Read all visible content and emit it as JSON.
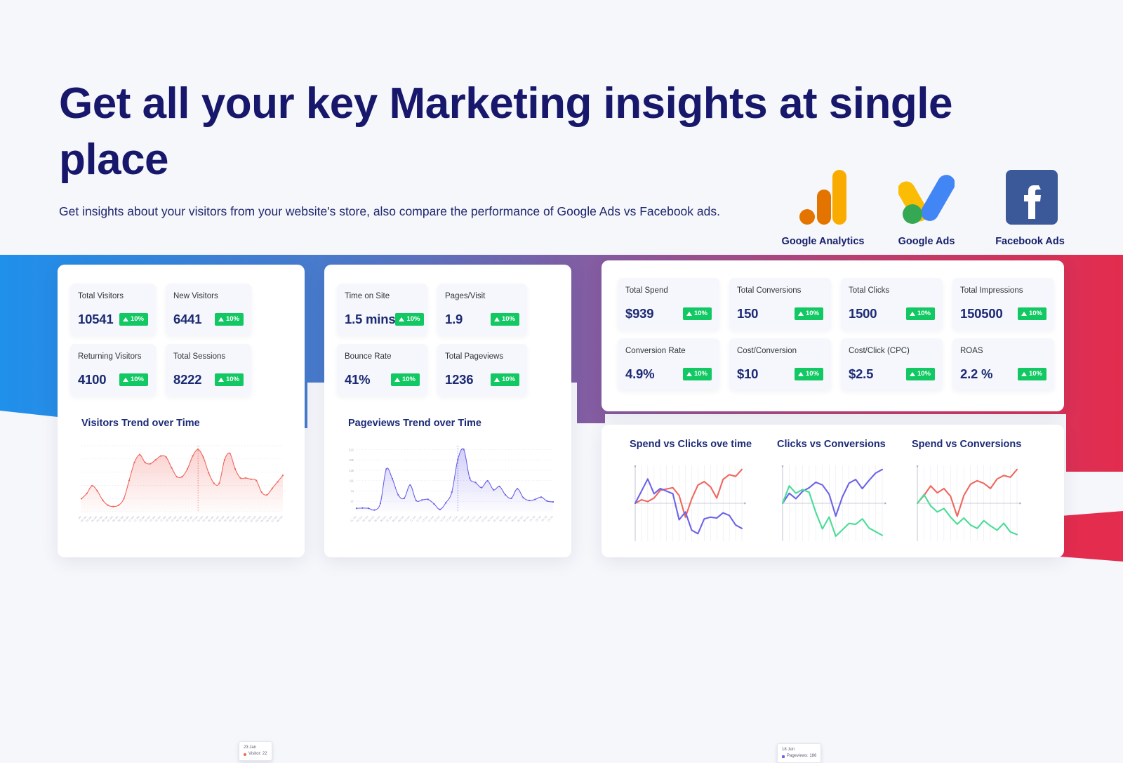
{
  "header": {
    "title": "Get all your key Marketing insights at single place",
    "subtitle": "Get insights about your visitors from your website's store, also compare the performance of Google Ads vs Facebook ads.",
    "logos": [
      {
        "icon": "google-analytics-icon",
        "label": "Google Analytics"
      },
      {
        "icon": "google-ads-icon",
        "label": "Google Ads"
      },
      {
        "icon": "facebook-ads-icon",
        "label": "Facebook Ads"
      }
    ]
  },
  "colors": {
    "title_navy": "#17176b",
    "accent_blue": "#1f90eb",
    "accent_purple": "#8a5a9e",
    "accent_red": "#e32c4e",
    "badge_green": "#12c863",
    "line_red": "#f0675e",
    "line_blue": "#6b63e8",
    "line_green": "#49dd96",
    "value_navy": "#1b2a73"
  },
  "panels": {
    "analytics": {
      "kpis": [
        {
          "label": "Total Visitors",
          "value": "10541",
          "delta": "10%",
          "trend": "up"
        },
        {
          "label": "New Visitors",
          "value": "6441",
          "delta": "10%",
          "trend": "up"
        },
        {
          "label": "Returning Visitors",
          "value": "4100",
          "delta": "10%",
          "trend": "up"
        },
        {
          "label": "Total Sessions",
          "value": "8222",
          "delta": "10%",
          "trend": "up"
        }
      ],
      "chart_title": "Visitors Trend over Time",
      "tooltip": {
        "date": "23 Jan",
        "series": "Visitor",
        "value": "22"
      }
    },
    "engagement": {
      "kpis": [
        {
          "label": "Time on Site",
          "value": "1.5 mins",
          "delta": "10%",
          "trend": "up"
        },
        {
          "label": "Pages/Visit",
          "value": "1.9",
          "delta": "10%",
          "trend": "up"
        },
        {
          "label": "Bounce Rate",
          "value": "41%",
          "delta": "10%",
          "trend": "up"
        },
        {
          "label": "Total Pageviews",
          "value": "1236",
          "delta": "10%",
          "trend": "up"
        }
      ],
      "chart_title": "Pageviews Trend over Time",
      "tooltip": {
        "date": "18 Jun",
        "series": "Pageviews",
        "value": "186"
      }
    },
    "ads": {
      "kpis": [
        {
          "label": "Total Spend",
          "value": "$939",
          "delta": "10%",
          "trend": "up"
        },
        {
          "label": "Total Conversions",
          "value": "150",
          "delta": "10%",
          "trend": "up"
        },
        {
          "label": "Total Clicks",
          "value": "1500",
          "delta": "10%",
          "trend": "up"
        },
        {
          "label": "Total Impressions",
          "value": "150500",
          "delta": "10%",
          "trend": "up"
        },
        {
          "label": "Conversion Rate",
          "value": "4.9%",
          "delta": "10%",
          "trend": "up"
        },
        {
          "label": "Cost/Conversion",
          "value": "$10",
          "delta": "10%",
          "trend": "up"
        },
        {
          "label": "Cost/Click (CPC)",
          "value": "$2.5",
          "delta": "10%",
          "trend": "up"
        },
        {
          "label": "ROAS",
          "value": "2.2 %",
          "delta": "10%",
          "trend": "up"
        }
      ],
      "mini_chart_titles": [
        "Spend vs Clicks ove time",
        "Clicks vs Conversions",
        "Spend vs Conversions"
      ]
    }
  },
  "chart_data": [
    {
      "type": "area",
      "title": "Visitors Trend over Time",
      "xlabel": "",
      "ylabel": "",
      "grid": true,
      "legend": "none",
      "series": [
        {
          "name": "Visitor",
          "color": "#f0675e",
          "values": [
            10,
            14,
            20,
            16,
            9,
            5,
            4,
            5,
            10,
            24,
            38,
            44,
            38,
            37,
            40,
            43,
            42,
            34,
            27,
            27,
            33,
            43,
            48,
            42,
            30,
            22,
            22,
            40,
            45,
            33,
            26,
            26,
            25,
            24,
            15,
            13,
            18,
            23,
            28
          ]
        }
      ],
      "x": [
        "01 Jan",
        "02 Jan",
        "03 Jan",
        "04 Jan",
        "05 Jan",
        "06 Jan",
        "07 Jan",
        "08 Jan",
        "09 Jan",
        "10 Jan",
        "11 Jan",
        "12 Jan",
        "13 Jan",
        "14 Jan",
        "15 Jan",
        "16 Jan",
        "17 Jan",
        "18 Jan",
        "19 Jan",
        "20 Jan",
        "21 Jan",
        "22 Jan",
        "23 Jan",
        "24 Jan",
        "25 Jan",
        "26 Jan",
        "27 Jan",
        "28 Jan",
        "29 Jan",
        "30 Jan",
        "31 Jan",
        "01 Feb",
        "02 Feb",
        "03 Feb",
        "04 Feb",
        "05 Feb",
        "06 Feb",
        "07 Feb",
        "08 Feb"
      ],
      "annotation": {
        "date": "23 Jan",
        "label": "Visitor",
        "value": 22
      }
    },
    {
      "type": "area",
      "title": "Pageviews Trend over Time",
      "xlabel": "",
      "ylabel": "",
      "grid": true,
      "legend": "none",
      "yticks": [
        0,
        37,
        74,
        111,
        148,
        185,
        222
      ],
      "ylim": [
        0,
        222
      ],
      "series": [
        {
          "name": "Pageviews",
          "color": "#6b63e8",
          "values": [
            12,
            13,
            12,
            6,
            30,
            152,
            118,
            60,
            48,
            95,
            40,
            42,
            44,
            28,
            8,
            32,
            70,
            186,
            222,
            120,
            104,
            86,
            110,
            78,
            90,
            60,
            48,
            82,
            50,
            40,
            44,
            52,
            38,
            35
          ]
        }
      ],
      "x": [
        "01 Jun",
        "02 Jun",
        "03 Jun",
        "04 Jun",
        "05 Jun",
        "06 Jun",
        "07 Jun",
        "08 Jun",
        "09 Jun",
        "10 Jun",
        "11 Jun",
        "12 Jun",
        "13 Jun",
        "14 Jun",
        "15 Jun",
        "16 Jun",
        "17 Jun",
        "18 Jun",
        "19 Jun",
        "20 Jun",
        "21 Jun",
        "22 Jun",
        "23 Jun",
        "24 Jun",
        "25 Jun",
        "26 Jun",
        "27 Jun",
        "28 Jun",
        "29 Jun",
        "30 Jun",
        "01 Jul",
        "02 Jul",
        "03 Jul",
        "04 Jul"
      ],
      "annotation": {
        "date": "18 Jun",
        "label": "Pageviews",
        "value": 186
      }
    },
    {
      "type": "line",
      "title": "Spend vs Clicks ove time",
      "grid": true,
      "legend": "none",
      "series": [
        {
          "name": "Spend",
          "color": "#f0675e",
          "values": [
            0,
            8,
            4,
            12,
            30,
            33,
            36,
            18,
            -32,
            10,
            42,
            50,
            38,
            12,
            55,
            66,
            62,
            78
          ]
        },
        {
          "name": "Clicks",
          "color": "#6b63e8",
          "values": [
            0,
            28,
            56,
            22,
            34,
            28,
            22,
            -38,
            -20,
            -62,
            -70,
            -36,
            -32,
            -34,
            -22,
            -28,
            -50,
            -58
          ]
        }
      ]
    },
    {
      "type": "line",
      "title": "Clicks vs Conversions",
      "grid": true,
      "legend": "none",
      "series": [
        {
          "name": "Clicks",
          "color": "#6b63e8",
          "values": [
            0,
            22,
            10,
            26,
            34,
            46,
            40,
            20,
            -28,
            14,
            44,
            52,
            32,
            50,
            66,
            74
          ]
        },
        {
          "name": "Conversions",
          "color": "#49dd96",
          "values": [
            0,
            38,
            22,
            30,
            24,
            -20,
            -56,
            -30,
            -72,
            -58,
            -44,
            -46,
            -34,
            -54,
            -62,
            -70
          ]
        }
      ]
    },
    {
      "type": "line",
      "title": "Spend vs Conversions",
      "grid": true,
      "legend": "none",
      "series": [
        {
          "name": "Spend",
          "color": "#f0675e",
          "values": [
            0,
            18,
            40,
            24,
            34,
            16,
            -30,
            18,
            44,
            52,
            46,
            34,
            56,
            64,
            60,
            78
          ]
        },
        {
          "name": "Conversions",
          "color": "#49dd96",
          "values": [
            0,
            20,
            -6,
            -20,
            -12,
            -32,
            -48,
            -34,
            -50,
            -58,
            -40,
            -52,
            -62,
            -46,
            -66,
            -72
          ]
        }
      ]
    }
  ]
}
